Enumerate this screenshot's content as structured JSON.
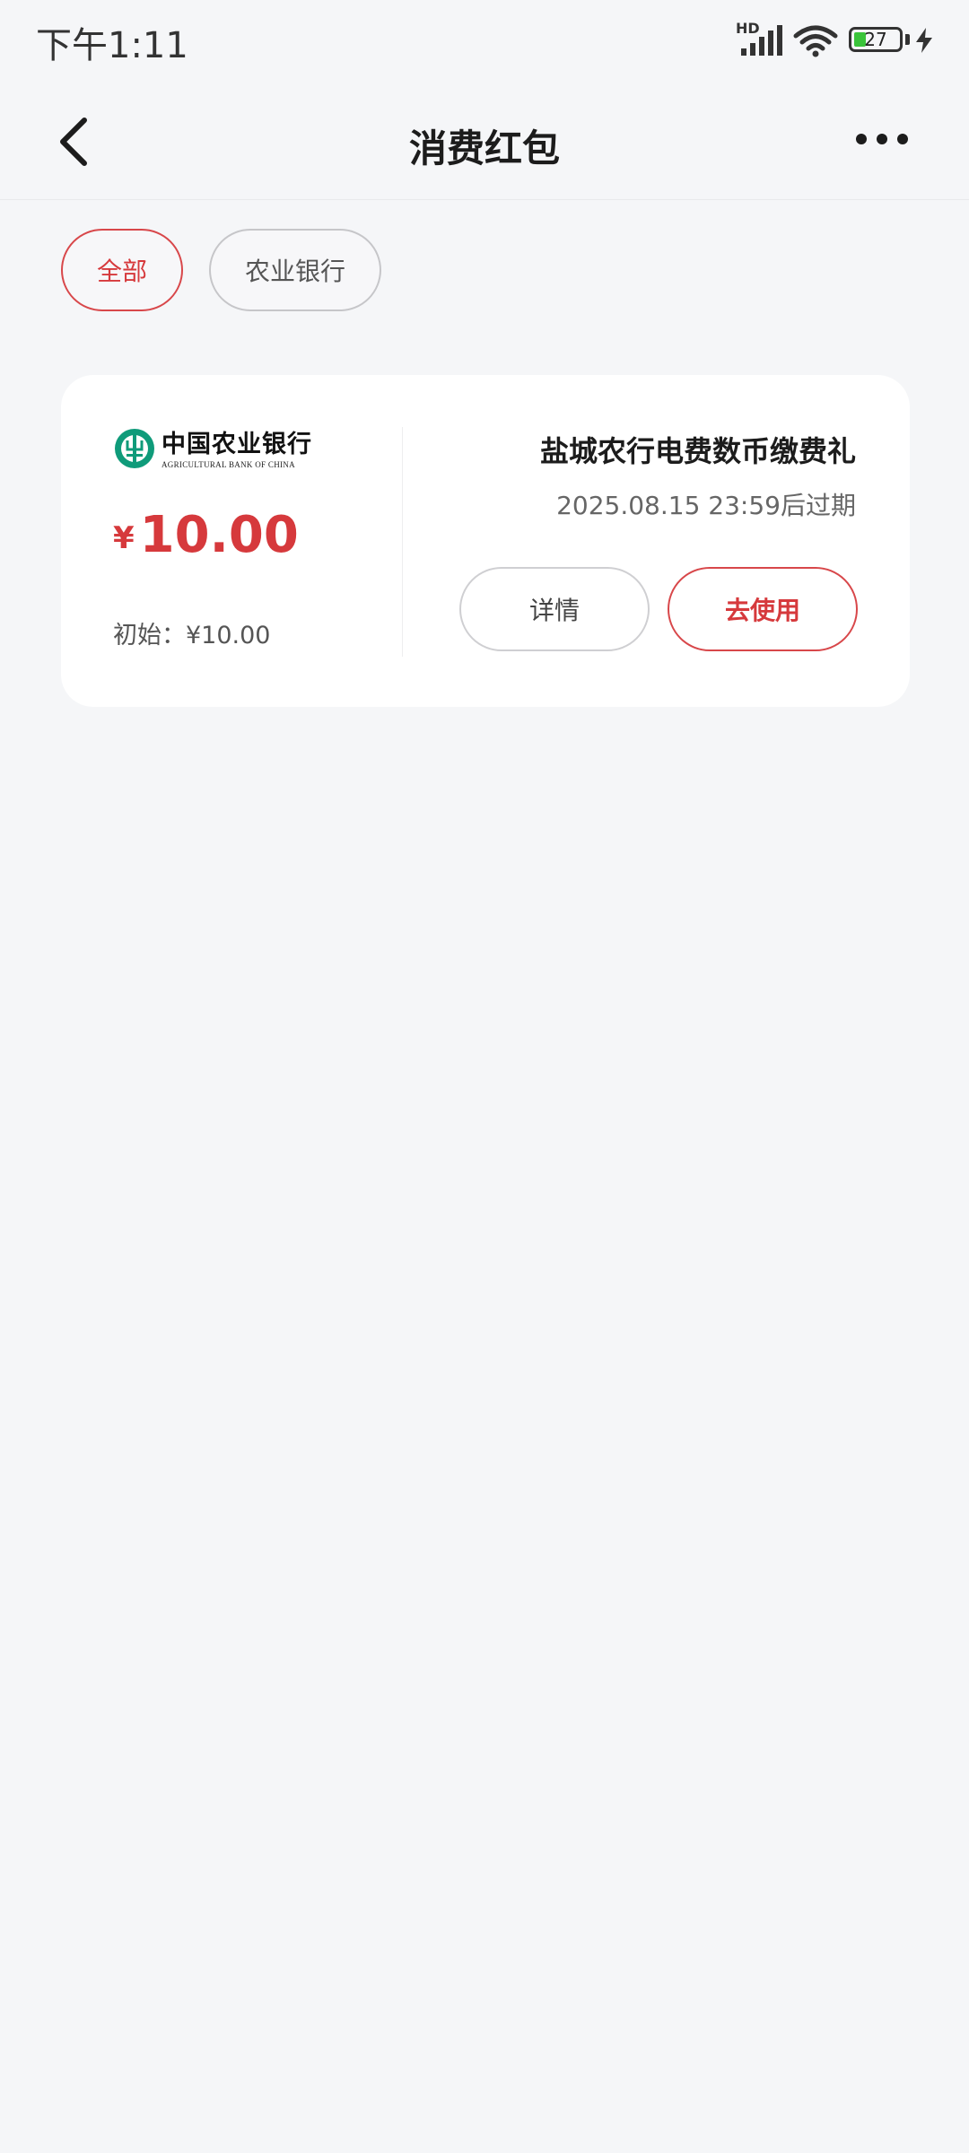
{
  "status_bar": {
    "time": "下午1:11",
    "network_label": "HD",
    "battery_level": "27",
    "battery_fraction": 0.27,
    "icons": [
      "signal-icon",
      "wifi-icon",
      "battery-icon",
      "charging-bolt-icon"
    ]
  },
  "header": {
    "title": "消费红包",
    "icons": [
      "back-arrow-icon",
      "more-dots-icon"
    ]
  },
  "filters": [
    {
      "label": "全部",
      "selected": true
    },
    {
      "label": "农业银行",
      "selected": false
    }
  ],
  "coupon": {
    "bank_name": "中国农业银行",
    "bank_name_en": "AGRICULTURAL BANK OF CHINA",
    "currency_symbol": "¥",
    "amount": "10.00",
    "initial_label": "初始：¥10.00",
    "title": "盐城农行电费数币缴费礼",
    "expiry": "2025.08.15 23:59后过期",
    "detail_button": "详情",
    "use_button": "去使用"
  },
  "colors": {
    "accent_red": "#d6393c",
    "background": "#f5f6f8",
    "card": "#ffffff",
    "bank_green": "#0f9b7a"
  }
}
